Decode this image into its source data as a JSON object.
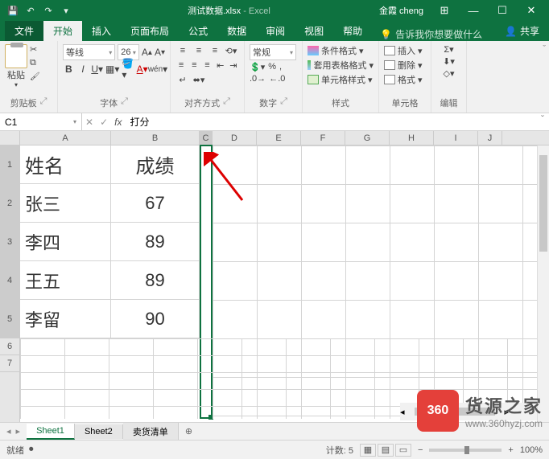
{
  "titlebar": {
    "filename": "测试数据.xlsx",
    "app": "Excel",
    "user": "金霞 cheng"
  },
  "tabs": {
    "file": "文件",
    "home": "开始",
    "insert": "插入",
    "pagelayout": "页面布局",
    "formulas": "公式",
    "data": "数据",
    "review": "审阅",
    "view": "视图",
    "help": "帮助",
    "tellme": "告诉我你想要做什么",
    "share": "共享"
  },
  "ribbon": {
    "clipboard": {
      "label": "剪贴板",
      "paste": "粘贴"
    },
    "font": {
      "label": "字体",
      "name": "等线",
      "size": "26"
    },
    "alignment": {
      "label": "对齐方式"
    },
    "number": {
      "label": "数字",
      "format": "常规"
    },
    "styles": {
      "label": "样式",
      "cond": "条件格式",
      "table": "套用表格格式",
      "cell": "单元格样式"
    },
    "cells": {
      "label": "单元格",
      "insert": "插入",
      "delete": "删除",
      "format": "格式"
    },
    "editing": {
      "label": "编辑"
    }
  },
  "formula": {
    "ref": "C1",
    "content": "打分"
  },
  "columns": [
    "A",
    "B",
    "C",
    "D",
    "E",
    "F",
    "G",
    "H",
    "I",
    "J"
  ],
  "rows": [
    "1",
    "2",
    "3",
    "4",
    "5",
    "6",
    "7"
  ],
  "data": {
    "A1": "姓名",
    "B1": "成绩",
    "A2": "张三",
    "B2": "67",
    "A3": "李四",
    "B3": "89",
    "A4": "王五",
    "B4": "89",
    "A5": "李留",
    "B5": "90"
  },
  "sheets": {
    "s1": "Sheet1",
    "s2": "Sheet2",
    "s3": "卖货清单"
  },
  "status": {
    "ready": "就绪",
    "count_label": "计数:",
    "count": "5",
    "zoom": "100%"
  },
  "watermark": {
    "brand": "360",
    "text": "货源之家",
    "url": "www.360hyzj.com"
  }
}
